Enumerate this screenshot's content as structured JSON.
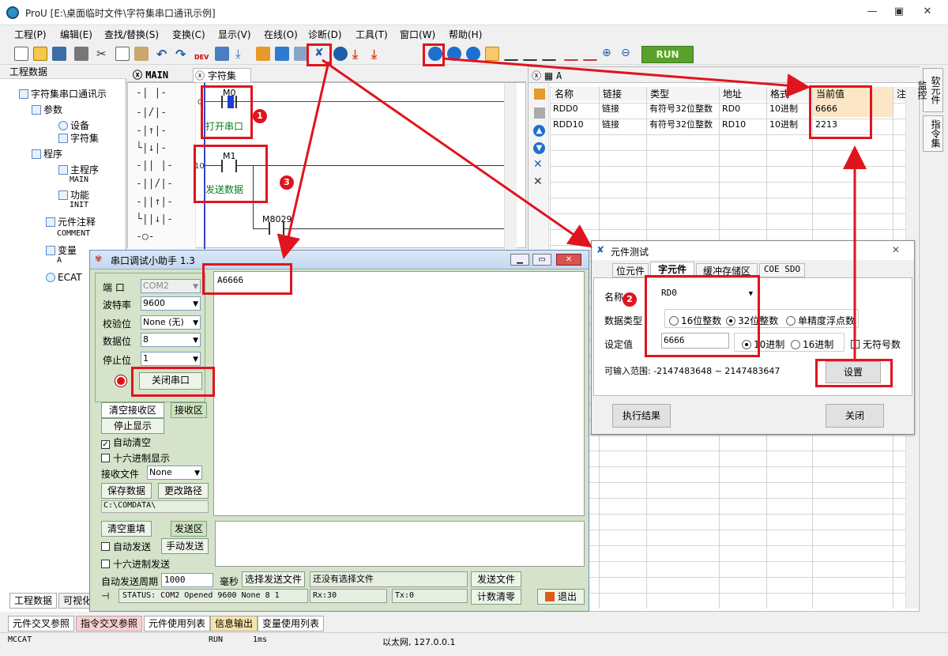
{
  "window": {
    "title": "ProU [E:\\桌面临时文件\\字符集串口通讯示例]"
  },
  "menu": [
    "工程(P)",
    "编辑(E)",
    "查找/替换(S)",
    "变换(C)",
    "显示(V)",
    "在线(O)",
    "诊断(D)",
    "工具(T)",
    "窗口(W)",
    "帮助(H)"
  ],
  "toolbar": {
    "run_label": "RUN",
    "dev_label": "DEV"
  },
  "project_panel": {
    "title": "工程数据",
    "pin": "ㅁ",
    "items": [
      {
        "label": "字符集串口通讯示"
      },
      {
        "label": "参数"
      },
      {
        "label": "设备"
      },
      {
        "label": "字符集"
      },
      {
        "label": "程序"
      },
      {
        "label": "主程序"
      },
      {
        "label": "MAIN"
      },
      {
        "label": "功能"
      },
      {
        "label": "INIT"
      },
      {
        "label": "元件注释"
      },
      {
        "label": "COMMENT"
      },
      {
        "label": "变量"
      },
      {
        "label": "A"
      },
      {
        "label": "ECAT"
      }
    ],
    "tabs": [
      "工程数据",
      "可视化"
    ]
  },
  "ladder": {
    "tab_main": "MAIN",
    "tab_charset": "字符集",
    "contact1": "M0",
    "comment1": "打开串口",
    "step2": "10",
    "contact2": "M1",
    "comment2": "发送数据",
    "contact3": "M8029",
    "step1": "0"
  },
  "monitor": {
    "tab": "A",
    "headers": [
      "名称",
      "链接",
      "类型",
      "地址",
      "格式",
      "当前值",
      "注"
    ],
    "rows": [
      [
        "RDD0",
        "链接",
        "有符号32位整数",
        "RD0",
        "10进制",
        "6666"
      ],
      [
        "RDD10",
        "链接",
        "有符号32位整数",
        "RD10",
        "10进制",
        "2213"
      ]
    ]
  },
  "right_tabs": [
    "软元件监控",
    "指令集"
  ],
  "serial": {
    "title": "串口调试小助手 1.3",
    "port_label": "端 口",
    "port": "COM2",
    "baud_label": "波特率",
    "baud": "9600",
    "parity_label": "校验位",
    "parity": "None (无)",
    "data_label": "数据位",
    "data": "8",
    "stop_label": "停止位",
    "stop": "1",
    "close_btn": "关闭串口",
    "clear_recv": "清空接收区",
    "recv_area": "接收区",
    "stop_show": "停止显示",
    "auto_clear": "自动清空",
    "hex_show": "十六进制显示",
    "recv_file": "接收文件",
    "recv_file_val": "None",
    "save_data": "保存数据",
    "change_path": "更改路径",
    "path": "C:\\COMDATA\\",
    "recv_text": "A6666",
    "clear_resend": "清空重填",
    "send_area": "发送区",
    "auto_send": "自动发送",
    "manual_send": "手动发送",
    "hex_send": "十六进制发送",
    "period_label": "自动发送周期",
    "period": "1000",
    "ms": "毫秒",
    "select_file": "选择发送文件",
    "no_file": "还没有选择文件",
    "send_file": "发送文件",
    "status": "STATUS: COM2 Opened 9600 None  8 1",
    "rx": "Rx:30",
    "tx": "Tx:0",
    "count_clear": "计数清零",
    "exit": "退出"
  },
  "ctest": {
    "title": "元件测试",
    "tabs": [
      "位元件",
      "字元件",
      "缓冲存储区",
      "COE SDO"
    ],
    "name_label": "名称",
    "name": "RD0",
    "dtype_label": "数据类型",
    "dtype_opts": [
      "16位整数",
      "32位整数",
      "单精度浮点数"
    ],
    "set_label": "设定值",
    "set_value": "6666",
    "base_opts": [
      "10进制",
      "16进制"
    ],
    "unsigned": "无符号数",
    "range": "可输入范围: -2147483648  ~  2147483647",
    "set_btn": "设置",
    "exec_btn": "执行结果",
    "close_btn": "关闭"
  },
  "badges": [
    "1",
    "2",
    "3"
  ],
  "bottom_tabs": [
    "元件交叉参照",
    "指令交叉参照",
    "元件使用列表",
    "信息输出",
    "变量使用列表"
  ],
  "statusbar": {
    "left": "MCCAT",
    "run": "RUN",
    "time": "1ms",
    "net": "以太网, 127.0.0.1"
  },
  "colors": {
    "annotation": "#e0141e",
    "serial_bg": "#d4e3c9",
    "run": "#5aa02c"
  }
}
